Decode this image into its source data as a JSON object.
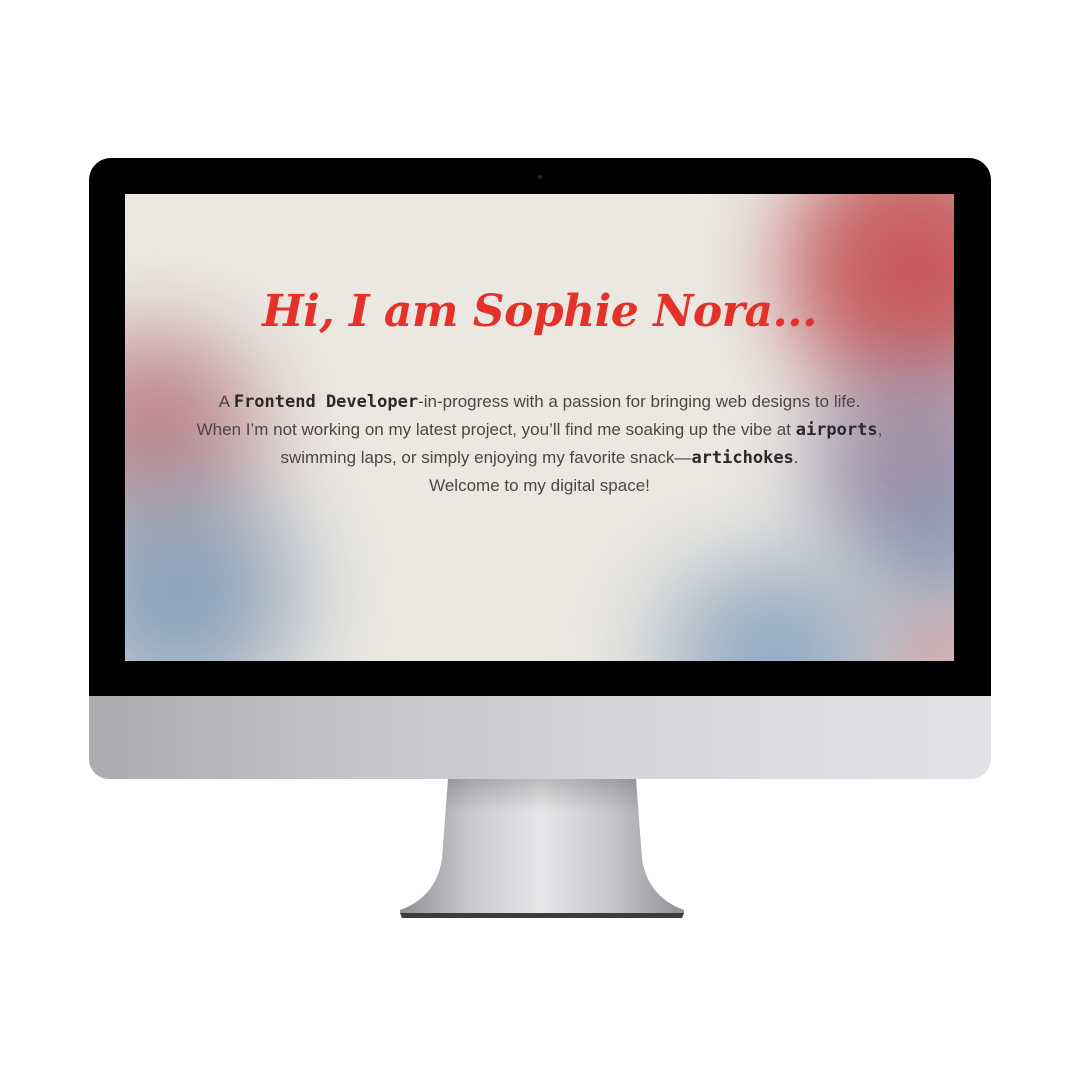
{
  "screen": {
    "headline": "Hi, I am Sophie Nora...",
    "intro": {
      "line1_pre": "A ",
      "line1_code": "Frontend Developer",
      "line1_post": "-in-progress with a passion for bringing web designs to life.",
      "line2_pre": "When I’m not working on my latest project, you’ll find me soaking up the vibe at ",
      "line2_code": "airports",
      "line2_post": ",",
      "line3_pre": "swimming laps, or simply enjoying my favorite snack—",
      "line3_code": "artichokes",
      "line3_post": ".",
      "line4": "Welcome to my digital space!"
    },
    "colors": {
      "headline": "#e4322b",
      "background": "#ebe8e2",
      "accent_red": "#cd4648",
      "accent_blue": "#6e8caf"
    }
  }
}
